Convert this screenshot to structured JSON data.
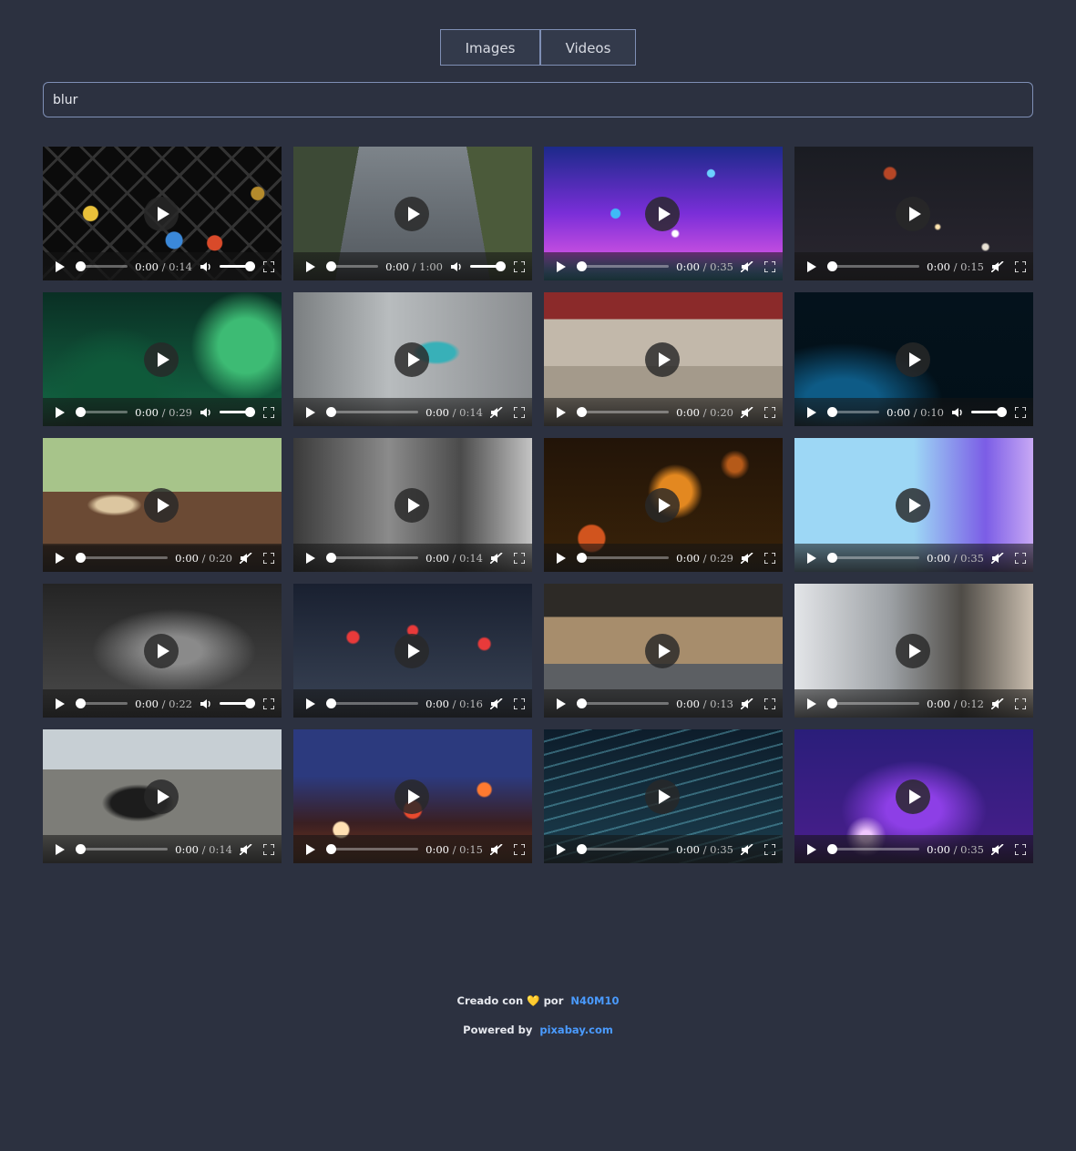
{
  "tabs": [
    {
      "label": "Images"
    },
    {
      "label": "Videos"
    }
  ],
  "search": {
    "value": "blur",
    "placeholder": ""
  },
  "videos": [
    {
      "thumb": "bokeh-fence",
      "current": "0:00",
      "duration": "0:14",
      "muted": false
    },
    {
      "thumb": "highway-traffic",
      "current": "0:00",
      "duration": "1:00",
      "muted": false
    },
    {
      "thumb": "blue-purple-bokeh",
      "current": "0:00",
      "duration": "0:35",
      "muted": true
    },
    {
      "thumb": "night-city-rain",
      "current": "0:00",
      "duration": "0:15",
      "muted": true
    },
    {
      "thumb": "green-blur",
      "current": "0:00",
      "duration": "0:29",
      "muted": false
    },
    {
      "thumb": "walking-man-street",
      "current": "0:00",
      "duration": "0:14",
      "muted": true
    },
    {
      "thumb": "walking-feet-crowd",
      "current": "0:00",
      "duration": "0:20",
      "muted": true
    },
    {
      "thumb": "dark-blue-gradient",
      "current": "0:00",
      "duration": "0:10",
      "muted": false
    },
    {
      "thumb": "cafe-people",
      "current": "0:00",
      "duration": "0:20",
      "muted": true
    },
    {
      "thumb": "bw-crowd",
      "current": "0:00",
      "duration": "0:14",
      "muted": true
    },
    {
      "thumb": "orange-bokeh-circles",
      "current": "0:00",
      "duration": "0:29",
      "muted": true
    },
    {
      "thumb": "light-blue-strands",
      "current": "0:00",
      "duration": "0:35",
      "muted": true
    },
    {
      "thumb": "grey-smoke",
      "current": "0:00",
      "duration": "0:22",
      "muted": false
    },
    {
      "thumb": "traffic-lights-blur",
      "current": "0:00",
      "duration": "0:16",
      "muted": true
    },
    {
      "thumb": "office-interior",
      "current": "0:00",
      "duration": "0:13",
      "muted": true
    },
    {
      "thumb": "office-workers",
      "current": "0:00",
      "duration": "0:12",
      "muted": true
    },
    {
      "thumb": "street-crowd-woman",
      "current": "0:00",
      "duration": "0:14",
      "muted": true
    },
    {
      "thumb": "night-bokeh-lights",
      "current": "0:00",
      "duration": "0:15",
      "muted": true
    },
    {
      "thumb": "teal-waves",
      "current": "0:00",
      "duration": "0:35",
      "muted": true
    },
    {
      "thumb": "purple-plasma",
      "current": "0:00",
      "duration": "0:35",
      "muted": true
    }
  ],
  "footer": {
    "created_prefix": "Creado con",
    "heart": "💛",
    "created_by": "por",
    "author_link": "N40M10",
    "powered_prefix": "Powered by",
    "powered_link": "pixabay.com"
  },
  "colors": {
    "background": "#2c3140",
    "accent_link": "#4a9bff",
    "border": "#7f8fb5"
  }
}
